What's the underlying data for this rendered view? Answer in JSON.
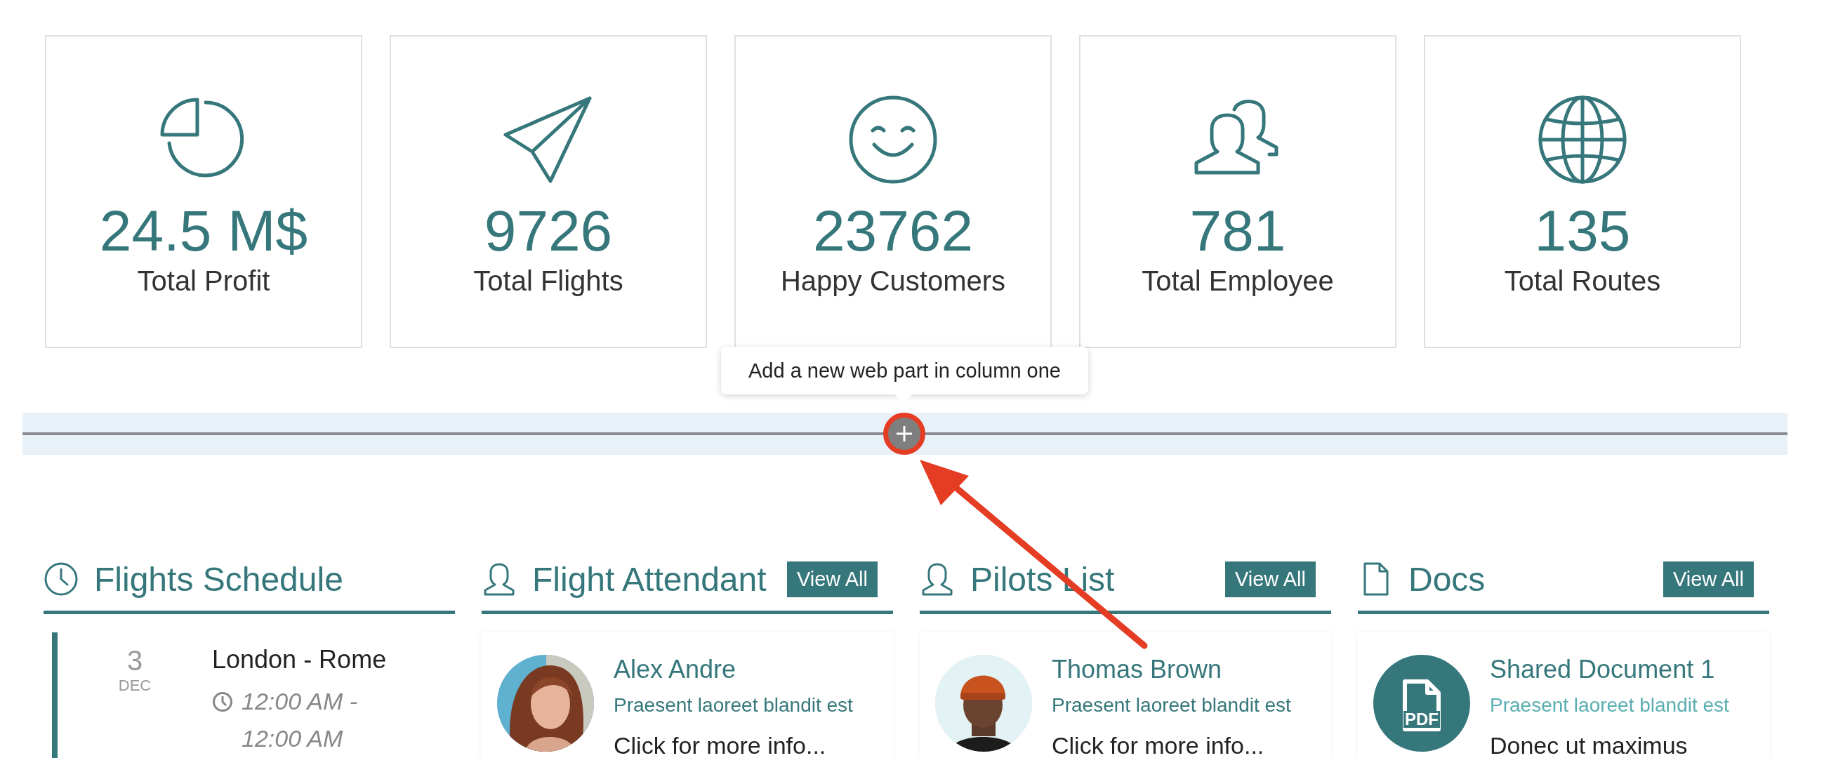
{
  "stats": [
    {
      "kind": "pie",
      "value": "24.5 M$",
      "label": "Total Profit"
    },
    {
      "kind": "plane",
      "value": "9726",
      "label": "Total Flights"
    },
    {
      "kind": "smile",
      "value": "23762",
      "label": "Happy Customers"
    },
    {
      "kind": "people",
      "value": "781",
      "label": "Total Employee"
    },
    {
      "kind": "globe",
      "value": "135",
      "label": "Total Routes"
    }
  ],
  "tooltip": {
    "text": "Add a new web part in column one"
  },
  "sections": [
    {
      "kind": "schedule",
      "title": "Flights Schedule",
      "items": [
        {
          "day": "3",
          "month": "DEC",
          "route": "London - Rome",
          "time": "12:00 AM - 12:00 AM"
        }
      ]
    },
    {
      "kind": "people",
      "title": "Flight Attendant",
      "view_all": "View All",
      "items": [
        {
          "kind": "woman",
          "name": "Alex Andre",
          "subtitle": "Praesent laoreet blandit est",
          "more": "Click for more info..."
        }
      ]
    },
    {
      "kind": "people",
      "title": "Pilots List",
      "view_all": "View All",
      "items": [
        {
          "kind": "man",
          "name": "Thomas Brown",
          "subtitle": "Praesent laoreet blandit est",
          "more": "Click for more info..."
        }
      ]
    },
    {
      "kind": "docs",
      "title": "Docs",
      "view_all": "View All",
      "items": [
        {
          "badge": "PDF",
          "name": "Shared Document 1",
          "subtitle": "Praesent laoreet blandit est",
          "more": "Donec ut maximus"
        }
      ]
    }
  ]
}
